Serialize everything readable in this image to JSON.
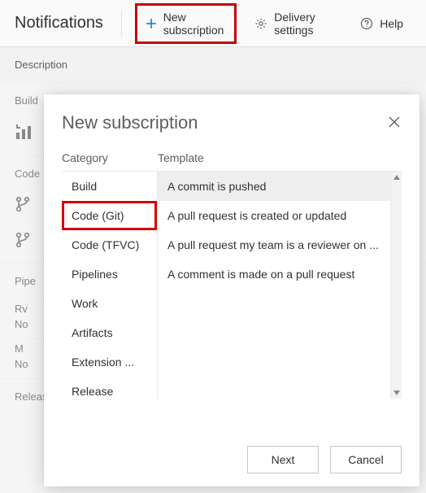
{
  "header": {
    "title": "Notifications",
    "new_label": "New subscription",
    "delivery_label": "Delivery settings",
    "help_label": "Help"
  },
  "descbar": {
    "label": "Description"
  },
  "bg_sections": {
    "build": "Build",
    "code": "Code",
    "pipe": "Pipe",
    "rv": "Rv",
    "no1": "No",
    "m": "M",
    "no2": "No",
    "release": "Release"
  },
  "modal": {
    "title": "New subscription",
    "category_heading": "Category",
    "template_heading": "Template",
    "categories": [
      {
        "label": "Build"
      },
      {
        "label": "Code (Git)",
        "selected": true
      },
      {
        "label": "Code (TFVC)"
      },
      {
        "label": "Pipelines"
      },
      {
        "label": "Work"
      },
      {
        "label": "Artifacts"
      },
      {
        "label": "Extension ..."
      },
      {
        "label": "Release"
      }
    ],
    "templates": [
      {
        "label": "A commit is pushed",
        "selected": true
      },
      {
        "label": "A pull request is created or updated"
      },
      {
        "label": "A pull request my team is a reviewer on ..."
      },
      {
        "label": "A comment is made on a pull request"
      }
    ],
    "buttons": {
      "next": "Next",
      "cancel": "Cancel"
    }
  }
}
